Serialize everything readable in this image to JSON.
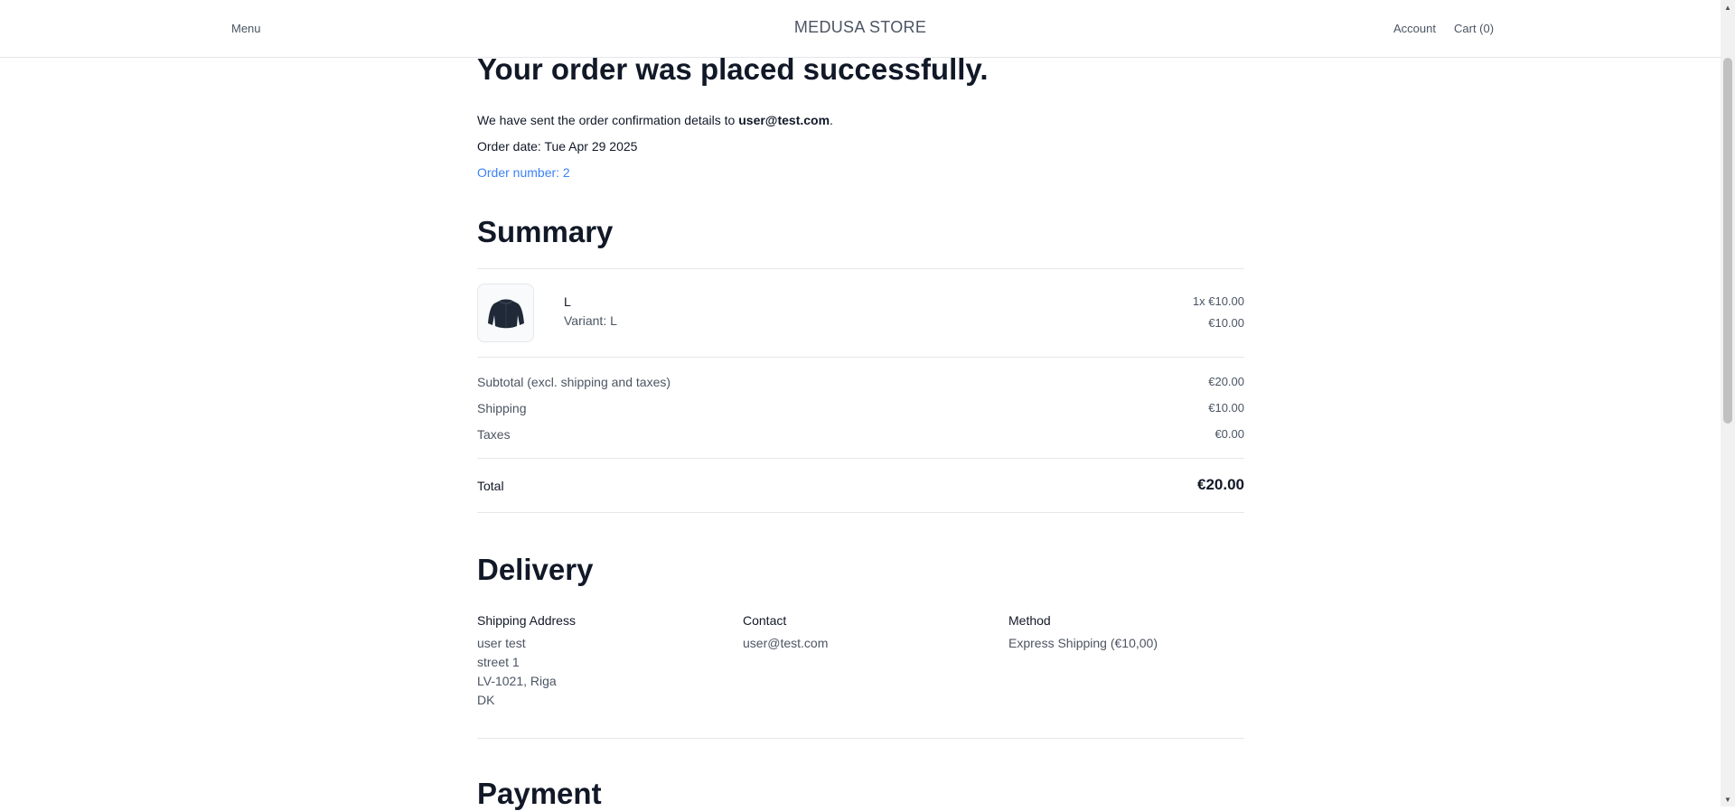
{
  "nav": {
    "menu": "Menu",
    "brand": "MEDUSA STORE",
    "account": "Account",
    "cart": "Cart (0)"
  },
  "confirmation": {
    "heading": "Your order was placed successfully.",
    "sent_text": "We have sent the order confirmation details to ",
    "email": "user@test.com",
    "email_suffix": ".",
    "order_date": "Order date: Tue Apr 29 2025",
    "order_number": "Order number: 2"
  },
  "summary": {
    "heading": "Summary",
    "item": {
      "title": "L",
      "variant": "Variant: L",
      "qty_price": "1x €10.00",
      "line_total": "€10.00",
      "image": "jacket-thumbnail"
    },
    "subtotal_label": "Subtotal (excl. shipping and taxes)",
    "subtotal_value": "€20.00",
    "shipping_label": "Shipping",
    "shipping_value": "€10.00",
    "taxes_label": "Taxes",
    "taxes_value": "€0.00",
    "total_label": "Total",
    "total_value": "€20.00"
  },
  "delivery": {
    "heading": "Delivery",
    "shipping_address_label": "Shipping Address",
    "address_lines": [
      "user test",
      "street 1",
      "LV-1021, Riga",
      "DK"
    ],
    "contact_label": "Contact",
    "contact_email": "user@test.com",
    "method_label": "Method",
    "method_value": "Express Shipping (€10,00)"
  },
  "payment": {
    "heading": "Payment"
  },
  "colors": {
    "link": "#3b82f6",
    "text": "#111827",
    "muted": "#4b5563",
    "divider": "#e5e7eb"
  }
}
